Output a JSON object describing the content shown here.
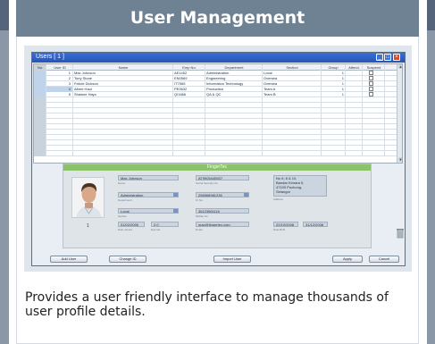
{
  "card": {
    "title": "User Management"
  },
  "window": {
    "title": "Users  [ 1 ]",
    "controls": {
      "minimize": "_",
      "maximize": "□",
      "close": "×"
    }
  },
  "table": {
    "columns": [
      "No.",
      "User ID",
      "Name",
      "Emp No.",
      "Department",
      "Section",
      "Group",
      "Attend.",
      "Suspend"
    ],
    "rows": [
      {
        "no": "",
        "id": "1",
        "name": "Max Johnson",
        "emp": "AE1452",
        "dept": "Administration",
        "sect": "Local",
        "group": "1"
      },
      {
        "no": "",
        "id": "2",
        "name": "Tony Stone",
        "emp": "EN0569",
        "dept": "Engineering",
        "sect": "Oversea",
        "group": "1"
      },
      {
        "no": "",
        "id": "3",
        "name": "Felicie Dickson",
        "emp": "IT7565",
        "dept": "Information Technology",
        "sect": "Oversea",
        "group": "1"
      },
      {
        "no": "",
        "id": "4",
        "name": "Albert Haul",
        "emp": "PE0632",
        "dept": "Production",
        "sect": "Team A",
        "group": "1"
      },
      {
        "no": "",
        "id": "5",
        "name": "Shawne Hayo",
        "emp": "QI1666",
        "dept": "QA & QC",
        "sect": "Team B",
        "group": "1"
      }
    ],
    "empty_rows": 11
  },
  "detail": {
    "header": "FingerTec",
    "photo_number": "1",
    "fields": {
      "name": "Max Johnson",
      "department": "Administration",
      "section": "Local",
      "start_date": "01/02/2005",
      "emp_no": "AT9905445507",
      "card_no": "256568981236",
      "phone": "36123561116",
      "email": "max@fingertec.com",
      "end_date": "",
      "dob_a": "22/10/2008",
      "dob_b": "31/12/2008",
      "time": "2.0"
    },
    "address": [
      "No 6, 8 & 10,",
      "Jalan BK 3/2,",
      "Bandar Kinrara 5,",
      "47100 Puchong,",
      "Selangor"
    ],
    "labels": {
      "name": "Name",
      "department": "Department",
      "section": "Section",
      "start_date": "Date Joined",
      "emp_no": "Social Security No.",
      "card_no": "IC No.",
      "phone": "Mobile No.",
      "email": "Email",
      "address": "Address",
      "dob": "Date Birth",
      "expiry": "Expired"
    }
  },
  "buttons": {
    "add_user": "Add User",
    "change_id": "Change ID",
    "import_user": "Import User",
    "apply": "Apply",
    "cancel": "Cancel"
  },
  "description": "Provides a user friendly interface to manage thousands of user profile details."
}
